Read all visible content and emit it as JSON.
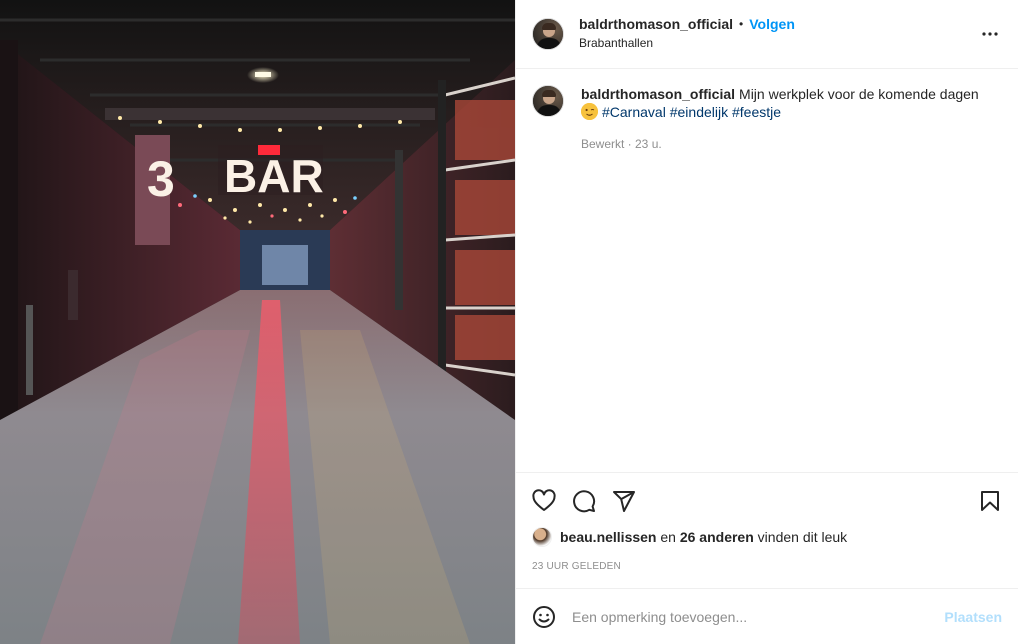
{
  "header": {
    "username": "baldrthomason_official",
    "separator": "•",
    "follow_label": "Volgen",
    "location": "Brabanthallen",
    "more_icon": "more-horizontal-icon"
  },
  "photo": {
    "sign_number": "3",
    "sign_text": "BAR"
  },
  "caption": {
    "username": "baldrthomason_official",
    "text": "Mijn werkplek voor de komende dagen",
    "emoji": "winking-face-emoji",
    "hashtags": [
      "#Carnaval",
      "#eindelijk",
      "#feestje"
    ],
    "meta": "Bewerkt · 23 u."
  },
  "actions": {
    "like_icon": "heart-icon",
    "comment_icon": "comment-icon",
    "share_icon": "paper-plane-icon",
    "save_icon": "bookmark-icon"
  },
  "likes": {
    "liker": "beau.nellissen",
    "and_word": "en",
    "others": "26 anderen",
    "suffix": "vinden dit leuk"
  },
  "timestamp": "23 uur geleden",
  "comment_box": {
    "placeholder": "Een opmerking toevoegen...",
    "post_label": "Plaatsen",
    "emoji_icon": "smiley-icon"
  },
  "colors": {
    "accent": "#0095f6",
    "hashtag": "#00376b",
    "muted": "#8e8e8e",
    "post_disabled": "#b2dffc"
  }
}
